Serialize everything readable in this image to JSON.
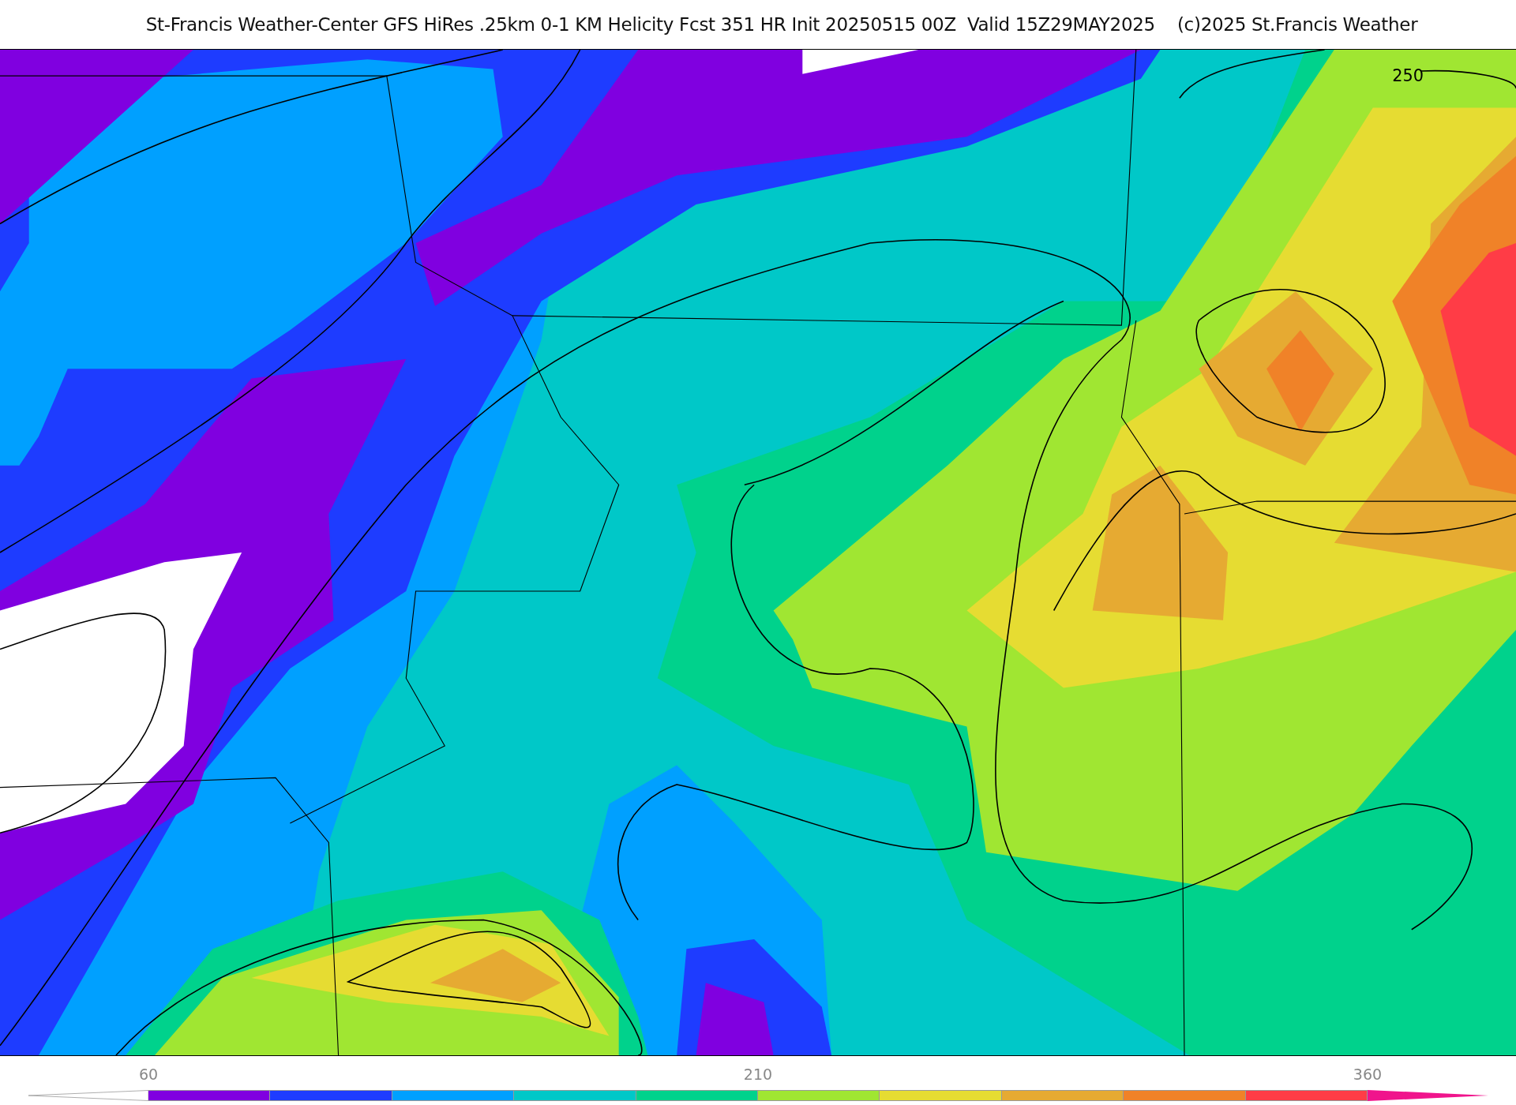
{
  "title": "St-Francis Weather-Center GFS HiRes .25km 0-1 KM Helicity Fcst 351 HR Init 20250515 00Z  Valid 15Z29MAY2025    (c)2025 St.Francis Weather",
  "map": {
    "contour_labels": [
      "250"
    ]
  },
  "colorbar": {
    "labels": [
      "60",
      "210",
      "360"
    ],
    "segments": [
      {
        "color": "#8000e0"
      },
      {
        "color": "#1e3cff"
      },
      {
        "color": "#00a0ff"
      },
      {
        "color": "#00c8c8"
      },
      {
        "color": "#00d28c"
      },
      {
        "color": "#a0e632"
      },
      {
        "color": "#e6dc32"
      },
      {
        "color": "#e6aa32"
      },
      {
        "color": "#f08228"
      },
      {
        "color": "#ff3c46"
      }
    ],
    "arrows": [
      {
        "color": "#ffffff"
      },
      {
        "color": "#f0148c"
      }
    ]
  }
}
